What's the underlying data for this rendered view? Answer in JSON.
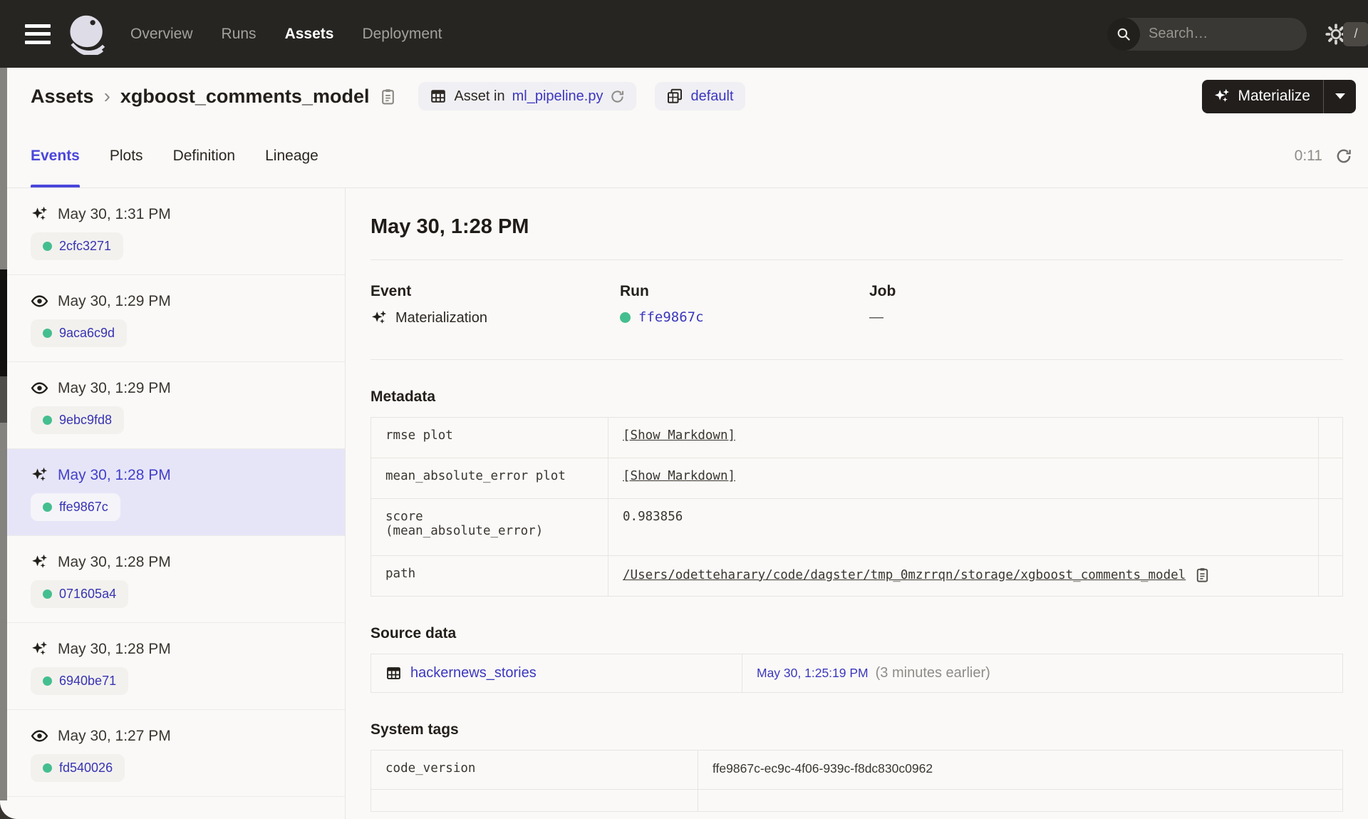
{
  "colors": {
    "navbar_bg": "#262522",
    "page_bg": "#FAF9F7",
    "accent_indigo": "#4B46DB",
    "link_indigo": "#3C37BF",
    "success_green": "#45BE8F",
    "selected_row_bg": "#E6E5F8"
  },
  "navbar": {
    "links": [
      {
        "label": "Overview",
        "active": false
      },
      {
        "label": "Runs",
        "active": false
      },
      {
        "label": "Assets",
        "active": true
      },
      {
        "label": "Deployment",
        "active": false
      }
    ],
    "search": {
      "placeholder": "Search…",
      "shortcut": "/"
    }
  },
  "header": {
    "breadcrumb_root": "Assets",
    "breadcrumb_sep": "›",
    "asset_name": "xgboost_comments_model",
    "code_location_prefix": "Asset in",
    "code_location_file": "ml_pipeline.py",
    "repo_badge": "default",
    "materialize_label": "Materialize"
  },
  "tabs": {
    "items": [
      "Events",
      "Plots",
      "Definition",
      "Lineage"
    ],
    "active": "Events",
    "refresh_timer": "0:11"
  },
  "sidebar": {
    "events": [
      {
        "type": "materialization",
        "time": "May 30, 1:31 PM",
        "run_id": "2cfc3271",
        "selected": false
      },
      {
        "type": "observation",
        "time": "May 30, 1:29 PM",
        "run_id": "9aca6c9d",
        "selected": false
      },
      {
        "type": "observation",
        "time": "May 30, 1:29 PM",
        "run_id": "9ebc9fd8",
        "selected": false
      },
      {
        "type": "materialization",
        "time": "May 30, 1:28 PM",
        "run_id": "ffe9867c",
        "selected": true
      },
      {
        "type": "materialization",
        "time": "May 30, 1:28 PM",
        "run_id": "071605a4",
        "selected": false
      },
      {
        "type": "materialization",
        "time": "May 30, 1:28 PM",
        "run_id": "6940be71",
        "selected": false
      },
      {
        "type": "observation",
        "time": "May 30, 1:27 PM",
        "run_id": "fd540026",
        "selected": false
      }
    ]
  },
  "detail": {
    "title": "May 30, 1:28 PM",
    "event": {
      "label": "Event",
      "value": "Materialization"
    },
    "run": {
      "label": "Run",
      "id": "ffe9867c"
    },
    "job": {
      "label": "Job",
      "value": "—"
    },
    "metadata": {
      "heading": "Metadata",
      "rows": [
        {
          "key": "rmse plot",
          "value": "[Show Markdown]"
        },
        {
          "key": "mean_absolute_error plot",
          "value": "[Show Markdown]"
        },
        {
          "key": "score\n(mean_absolute_error)",
          "value": "0.983856"
        },
        {
          "key": "path",
          "value": "/Users/odetteharary/code/dagster/tmp_0mzrrqn/storage/xgboost_comments_model"
        }
      ]
    },
    "source_data": {
      "heading": "Source data",
      "asset": "hackernews_stories",
      "timestamp": "May 30, 1:25:19 PM",
      "note": "(3 minutes earlier)"
    },
    "system_tags": {
      "heading": "System tags",
      "rows": [
        {
          "key": "code_version",
          "value": "ffe9867c-ec9c-4f06-939c-f8dc830c0962"
        }
      ]
    }
  }
}
